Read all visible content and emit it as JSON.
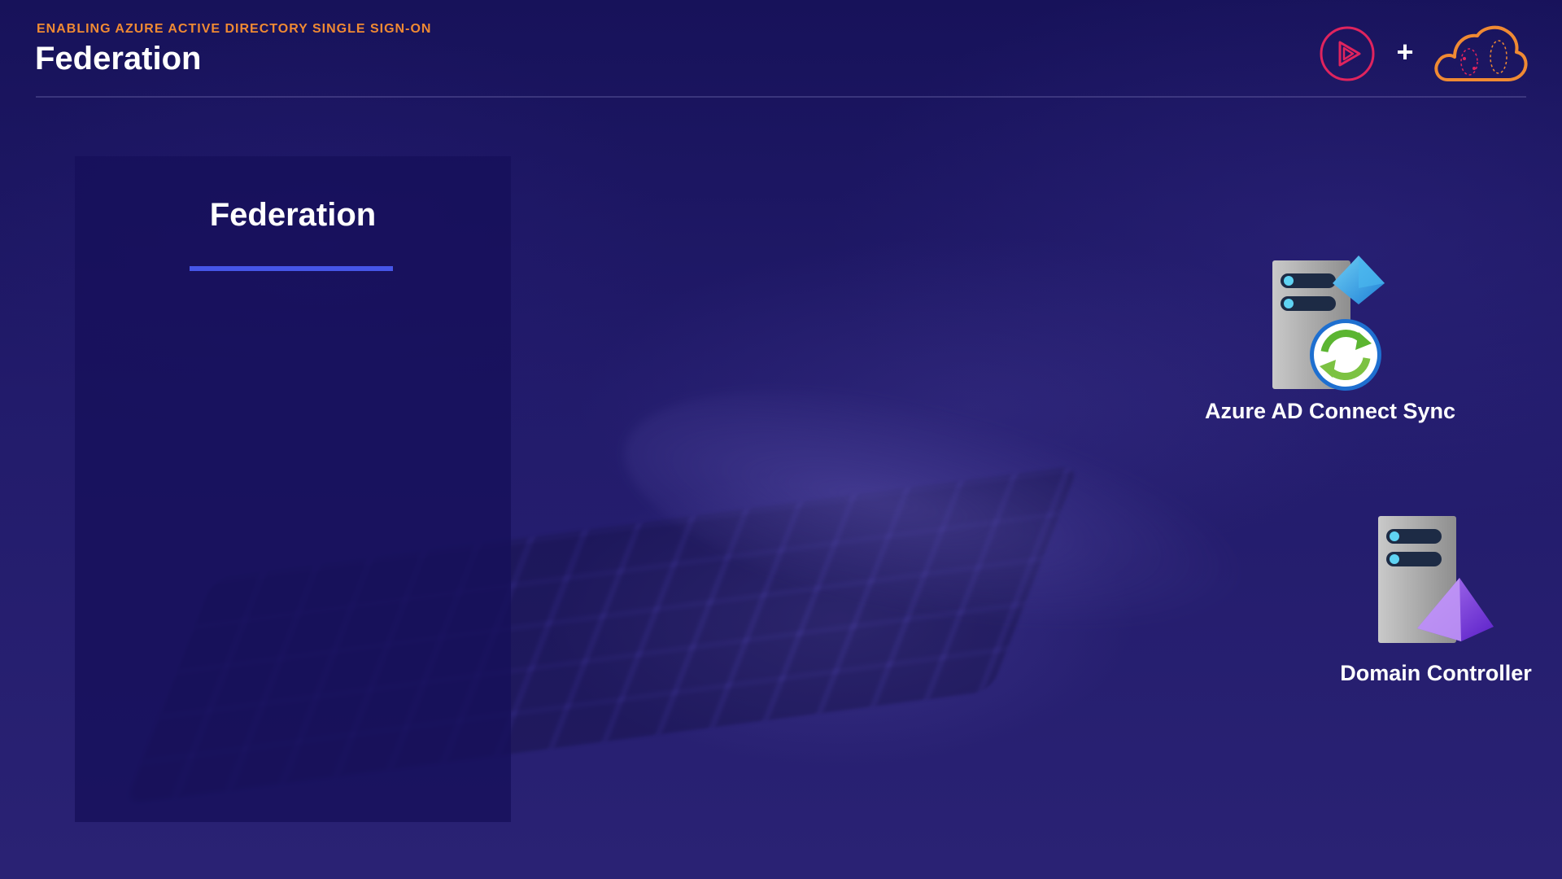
{
  "header": {
    "subtitle": "ENABLING AZURE ACTIVE DIRECTORY SINGLE SIGN-ON",
    "title": "Federation",
    "logos": {
      "left_icon": "play-logo-icon",
      "separator": "+",
      "right_icon": "cloud-logo-icon"
    }
  },
  "panel": {
    "title": "Federation"
  },
  "diagram": {
    "nodes": [
      {
        "icon": "azure-ad-connect-sync-icon",
        "label": "Azure AD Connect Sync"
      },
      {
        "icon": "domain-controller-icon",
        "label": "Domain Controller"
      }
    ]
  },
  "colors": {
    "background": "#1f1a63",
    "subtitle": "#f08a33",
    "accent_underline": "#4656e8",
    "play_logo": "#e0245e",
    "cloud_logo": "#f08a33"
  }
}
